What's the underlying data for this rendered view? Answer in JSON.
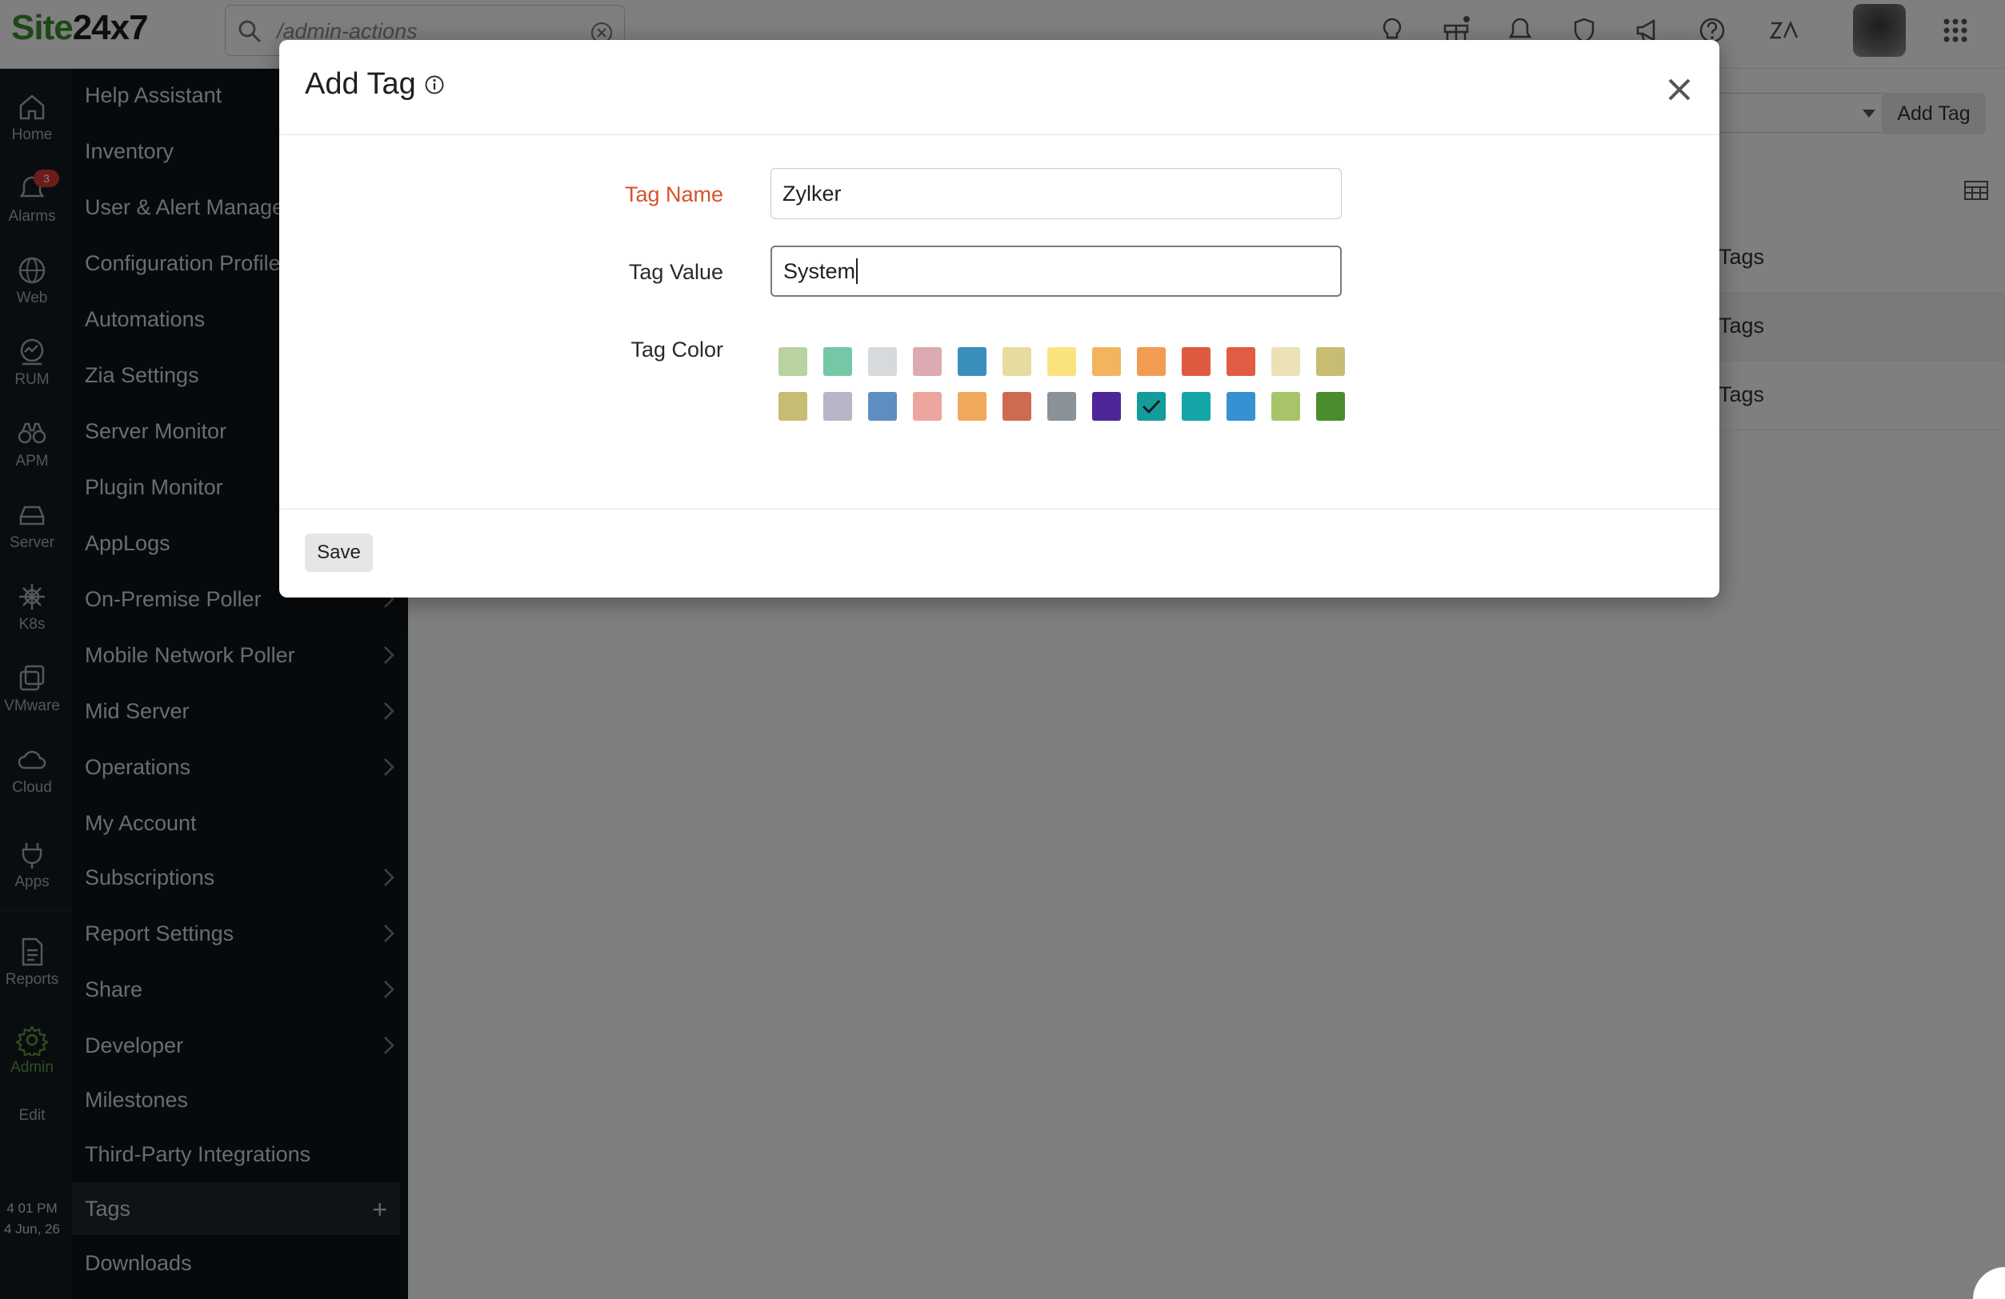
{
  "topbar": {
    "logo_site": "Site",
    "logo_rest": "24x7",
    "search_value": "/admin-actions"
  },
  "rail": {
    "items": [
      {
        "label": "Home",
        "icon": "home-icon"
      },
      {
        "label": "Alarms",
        "icon": "bell-icon",
        "badge": "3"
      },
      {
        "label": "Web",
        "icon": "globe-icon"
      },
      {
        "label": "RUM",
        "icon": "rum-icon"
      },
      {
        "label": "APM",
        "icon": "binoculars-icon"
      },
      {
        "label": "Server",
        "icon": "server-icon"
      },
      {
        "label": "K8s",
        "icon": "helm-icon"
      },
      {
        "label": "VMware",
        "icon": "vmware-icon"
      },
      {
        "label": "Cloud",
        "icon": "cloud-icon"
      },
      {
        "label": "Apps",
        "icon": "plug-icon"
      },
      {
        "label": "Reports",
        "icon": "report-icon"
      },
      {
        "label": "Admin",
        "icon": "gear-icon"
      },
      {
        "label": "Edit"
      }
    ],
    "time": "4 01 PM",
    "date": "4 Jun, 26"
  },
  "adminnav": {
    "items": [
      {
        "label": "Help Assistant"
      },
      {
        "label": "Inventory"
      },
      {
        "label": "User & Alert Management"
      },
      {
        "label": "Configuration Profiles"
      },
      {
        "label": "Automations"
      },
      {
        "label": "Zia Settings"
      },
      {
        "label": "Server Monitor"
      },
      {
        "label": "Plugin Monitor"
      },
      {
        "label": "AppLogs"
      },
      {
        "label": "On-Premise Poller"
      },
      {
        "label": "Mobile Network Poller"
      },
      {
        "label": "Mid Server"
      },
      {
        "label": "Operations"
      },
      {
        "label": "My Account"
      },
      {
        "label": "Subscriptions"
      },
      {
        "label": "Report Settings"
      },
      {
        "label": "Share"
      },
      {
        "label": "Developer"
      },
      {
        "label": "Milestones"
      },
      {
        "label": "Third-Party Integrations"
      },
      {
        "label": "Tags"
      },
      {
        "label": "Downloads"
      }
    ]
  },
  "main": {
    "add_tag_label": "Add Tag",
    "rows": [
      "Tags",
      "Tags",
      "Tags"
    ]
  },
  "modal": {
    "title": "Add Tag",
    "tag_name_label": "Tag Name",
    "tag_name_value": "Zylker",
    "tag_value_label": "Tag Value",
    "tag_value_value": "System",
    "tag_color_label": "Tag Color",
    "save_label": "Save",
    "selected_color": "#139c9c",
    "colors_row1": [
      "#b9d3a0",
      "#74c8a5",
      "#d6dadc",
      "#dcaab1",
      "#3a8fbd",
      "#e7dc9f",
      "#fbe37b",
      "#f3b45f",
      "#f29c52",
      "#e05a3f",
      "#e25b43",
      "#ebe1b6",
      "#c6bd72"
    ],
    "colors_row2": [
      "#c6bd72",
      "#b7b6c8",
      "#5e8ec0",
      "#eea59e",
      "#f0a95c",
      "#cf6a52",
      "#8b9199",
      "#4d2697",
      "#139c9c",
      "#14a6a6",
      "#3790d2",
      "#a7c468",
      "#4b8d2c"
    ]
  }
}
